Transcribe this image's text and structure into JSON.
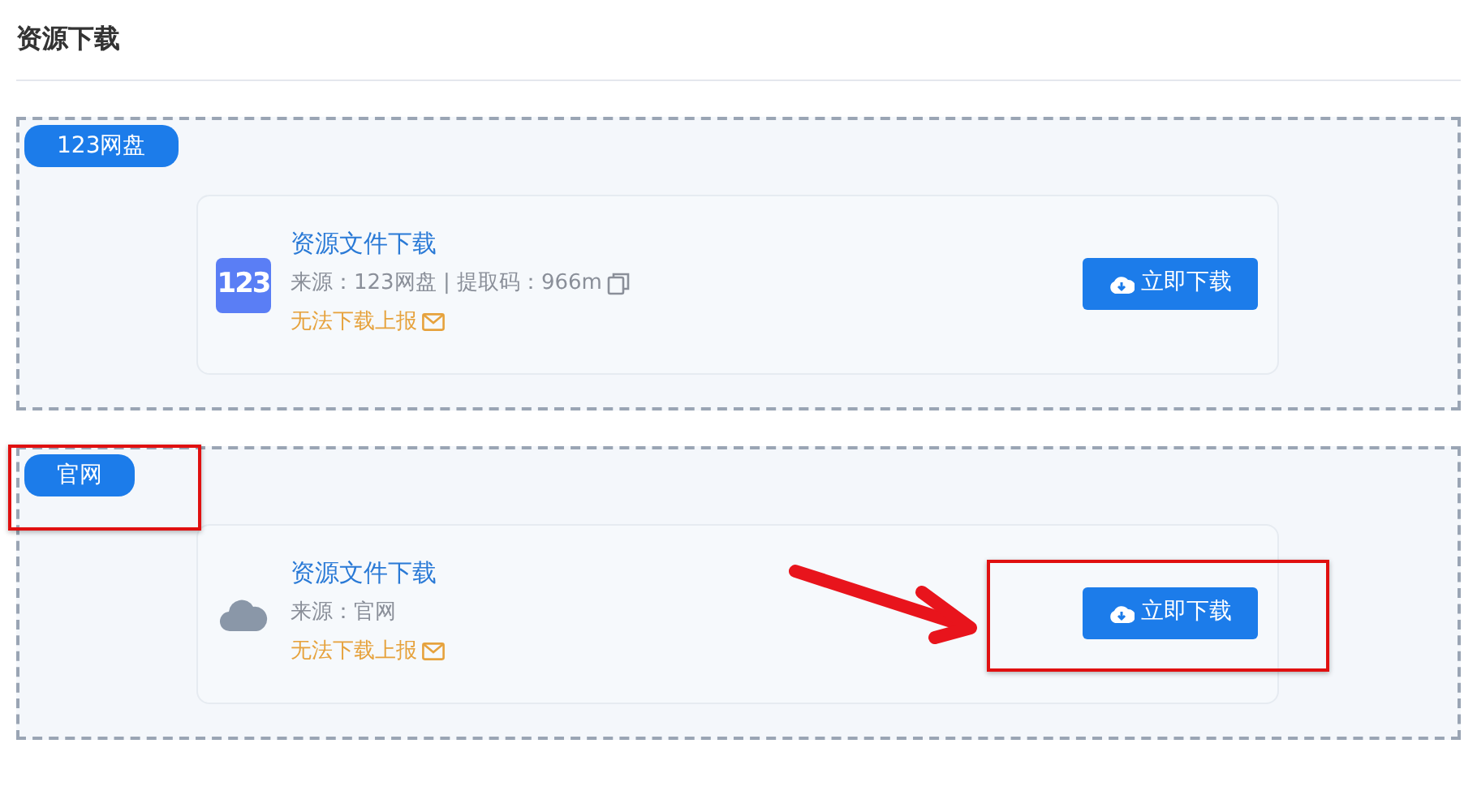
{
  "page_title": "资源下载",
  "sections": [
    {
      "tag": "123网盘",
      "tag_highlighted": false,
      "item": {
        "kind": "logo",
        "logo_text": "123",
        "title": "资源文件下载",
        "source": "来源：123网盘 | 提取码：966m",
        "copyable": true,
        "report": "无法下载上报",
        "button": "立即下载",
        "button_highlighted": false
      }
    },
    {
      "tag": "官网",
      "tag_highlighted": true,
      "item": {
        "kind": "cloud",
        "title": "资源文件下载",
        "source": "来源：官网",
        "copyable": false,
        "report": "无法下载上报",
        "button": "立即下载",
        "button_highlighted": true
      }
    }
  ]
}
